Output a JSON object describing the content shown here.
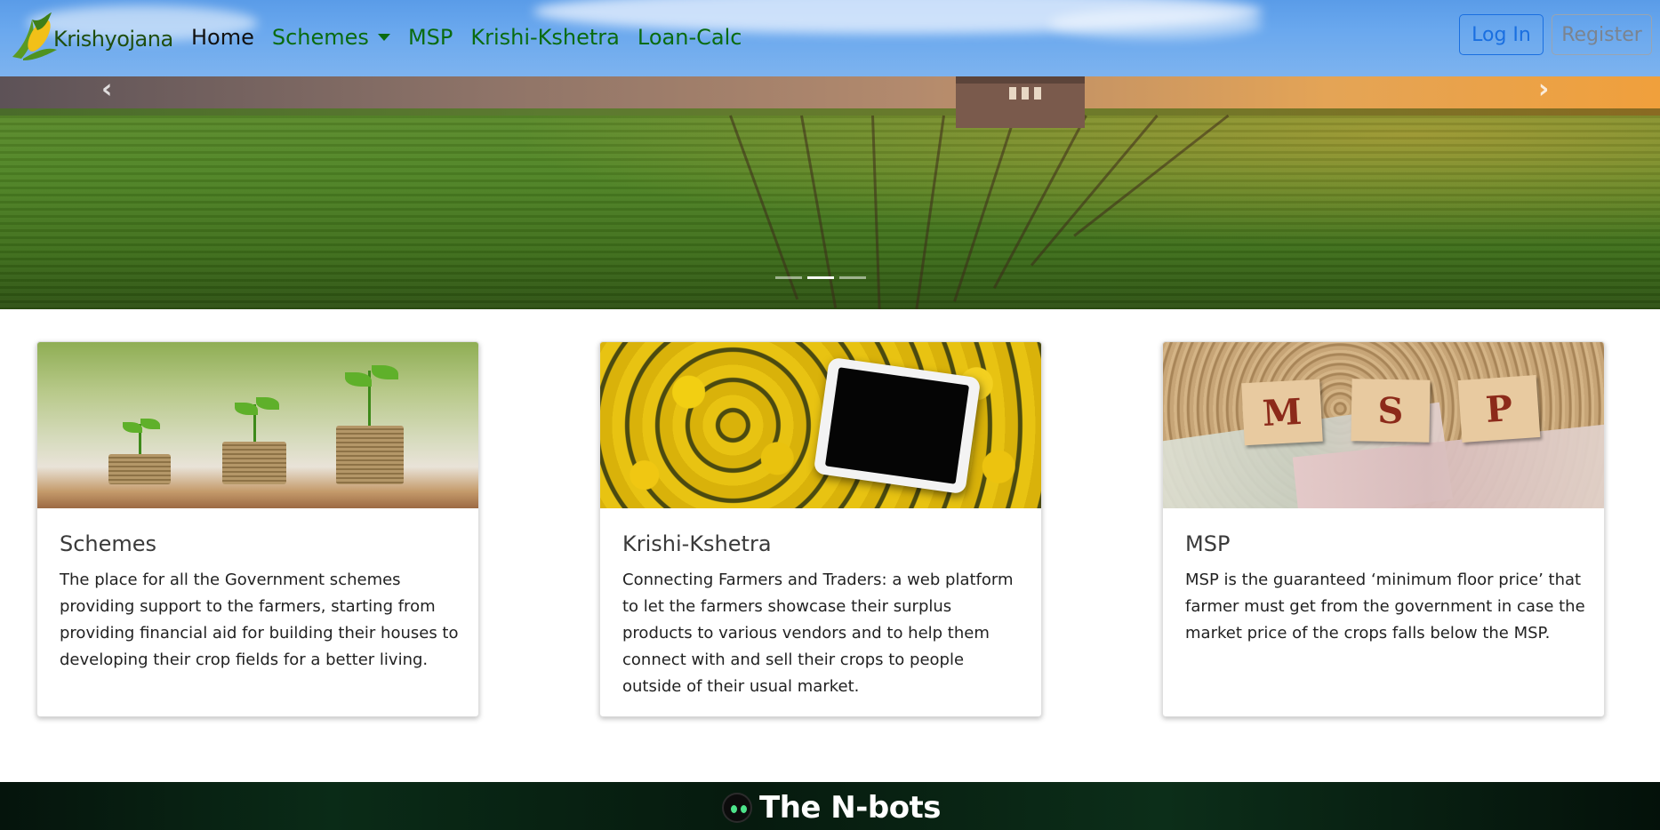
{
  "navbar": {
    "brand": "Krishyojana",
    "links": [
      {
        "label": "Home"
      },
      {
        "label": "Schemes"
      },
      {
        "label": "MSP"
      },
      {
        "label": "Krishi-Kshetra"
      },
      {
        "label": "Loan-Calc"
      }
    ],
    "login_label": "Log In",
    "register_label": "Register",
    "colors": {
      "link": "#0a6b10",
      "active_link": "#111111",
      "login": "#1a6fe0"
    }
  },
  "carousel": {
    "prev_icon": "chevron-left-icon",
    "next_icon": "chevron-right-icon",
    "slide_count": 3,
    "active_slide": 2
  },
  "cards": [
    {
      "title": "Schemes",
      "text": "The place for all the Government schemes providing support to the farmers, starting from providing financial aid for building their houses to developing their crop fields for a better living."
    },
    {
      "title": "Krishi-Kshetra",
      "text": "Connecting Farmers and Traders: a web platform to let the farmers showcase their surplus products to various vendors and to help them connect with and sell their crops to people outside of their usual market."
    },
    {
      "title": "MSP",
      "text": "MSP is the guaranteed ‘minimum floor price’ that farmer must get from the government in case the market price of the crops falls below the MSP.",
      "tiles": [
        "M",
        "S",
        "P"
      ]
    }
  ],
  "footer": {
    "title": "The N-bots"
  }
}
